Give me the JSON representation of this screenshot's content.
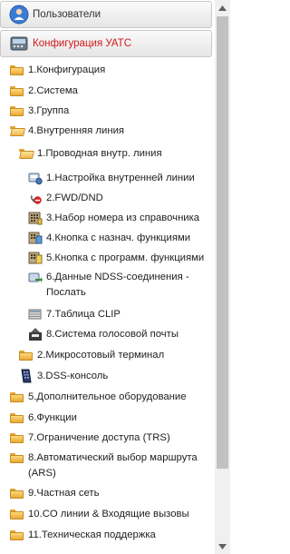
{
  "header": {
    "users_label": "Пользователи",
    "config_label": "Конфигурация УАТС"
  },
  "tree": {
    "items": [
      {
        "label": "1.Конфигурация"
      },
      {
        "label": "2.Система"
      },
      {
        "label": "3.Группа"
      },
      {
        "label": "4.Внутренняя линия"
      },
      {
        "label": "1.Проводная внутр. линия"
      },
      {
        "label": "1.Настройка внутренней линии",
        "icon": "phone-settings-icon"
      },
      {
        "label": "2.FWD/DND",
        "icon": "dnd-icon"
      },
      {
        "label": "3.Набор номера из справочника",
        "icon": "directory-dial-icon"
      },
      {
        "label": "4.Кнопка с назнач. функциями",
        "icon": "function-keys-icon"
      },
      {
        "label": "5.Кнопка с программ. функциями",
        "icon": "programmable-keys-icon"
      },
      {
        "label": "6.Данные NDSS-соединения -",
        "label2": "Послать",
        "icon": "ndss-send-icon"
      },
      {
        "label": "7.Таблица CLIP",
        "icon": "clip-table-icon"
      },
      {
        "label": "8.Система голосовой почты",
        "icon": "voicemail-icon"
      },
      {
        "label": "2.Микросотовый терминал"
      },
      {
        "label": "3.DSS-консоль",
        "icon": "dss-console-icon"
      },
      {
        "label": "5.Дополнительное оборудование"
      },
      {
        "label": "6.Функции"
      },
      {
        "label": "7.Ограничение доступа (TRS)"
      },
      {
        "label": "8.Автоматический выбор маршрута",
        "label2": "(ARS)"
      },
      {
        "label": "9.Частная сеть"
      },
      {
        "label": "10.CO линии & Входящие вызовы"
      },
      {
        "label": "11.Техническая поддержка"
      }
    ]
  },
  "scrollbar": {
    "position_fraction": 0.0
  }
}
